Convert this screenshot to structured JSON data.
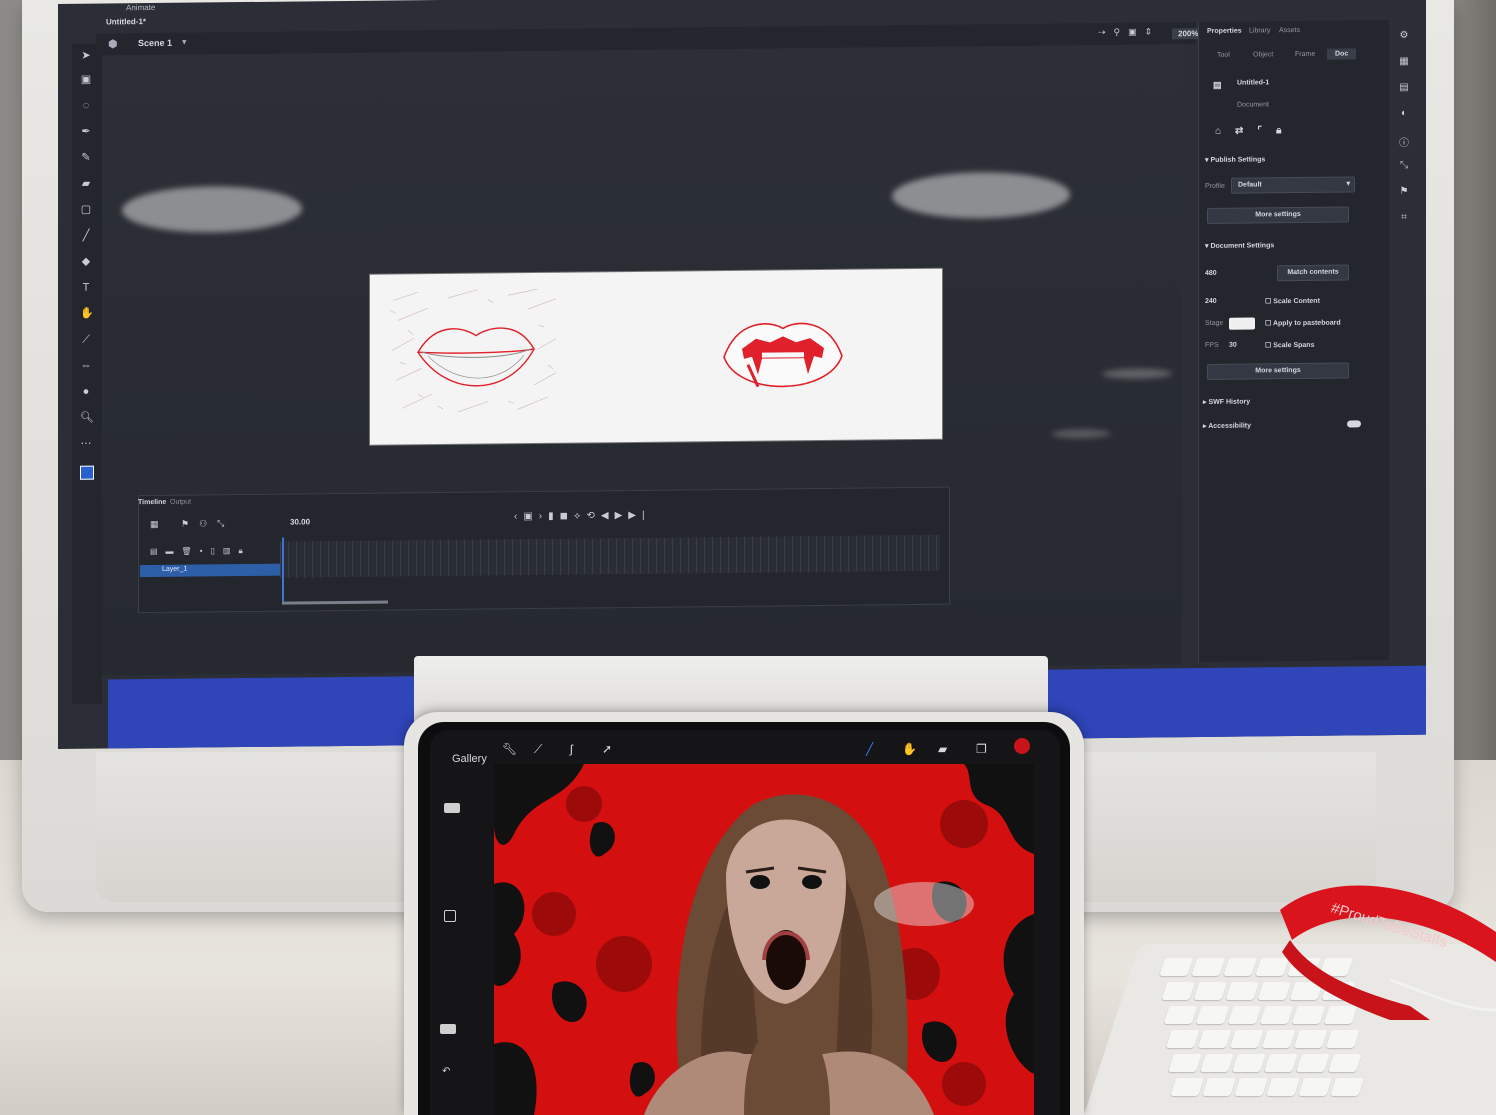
{
  "animate_ui": {
    "app_title": "Animate",
    "document_tab": "Untitled-1*",
    "scene_label": "Scene 1",
    "zoom": "200%",
    "timeline": {
      "tab_timeline": "Timeline",
      "tab_output": "Output",
      "fps": "30.00",
      "layer_name": "Layer_1"
    },
    "properties": {
      "tabs": [
        "Properties",
        "Library",
        "Assets"
      ],
      "subtabs": [
        "Tool",
        "Object",
        "Frame",
        "Doc"
      ],
      "doc_name": "Untitled-1",
      "doc_type": "Document",
      "publish_settings": "Publish Settings",
      "profile_label": "Profile",
      "profile_value": "Default",
      "more_settings_1": "More settings",
      "document_settings": "Document Settings",
      "width": "480",
      "height": "240",
      "match_contents": "Match contents",
      "scale_content": "Scale Content",
      "stage_label": "Stage",
      "apply_to_pasteboard": "Apply to pasteboard",
      "fps_label": "FPS",
      "fps_value": "30",
      "scale_spans": "Scale Spans",
      "more_settings_2": "More settings",
      "swf_history": "SWF History",
      "accessibility": "Accessibility"
    }
  },
  "procreate_ui": {
    "gallery": "Gallery",
    "icons": [
      "wrench-icon",
      "magic-wand-icon",
      "selection-icon",
      "transform-icon",
      "brush-icon",
      "smudge-icon",
      "eraser-icon",
      "layers-icon",
      "color-icon"
    ]
  },
  "lanyard_text": "#ProudToBeStaffs",
  "colors": {
    "animate_bg": "#2b2e36",
    "stage": "#f4f4f4",
    "sketch_red": "#e0202a",
    "artwork_red": "#d40f0f",
    "screen_blue": "#2f45b8",
    "lanyard_red": "#d9141d"
  }
}
